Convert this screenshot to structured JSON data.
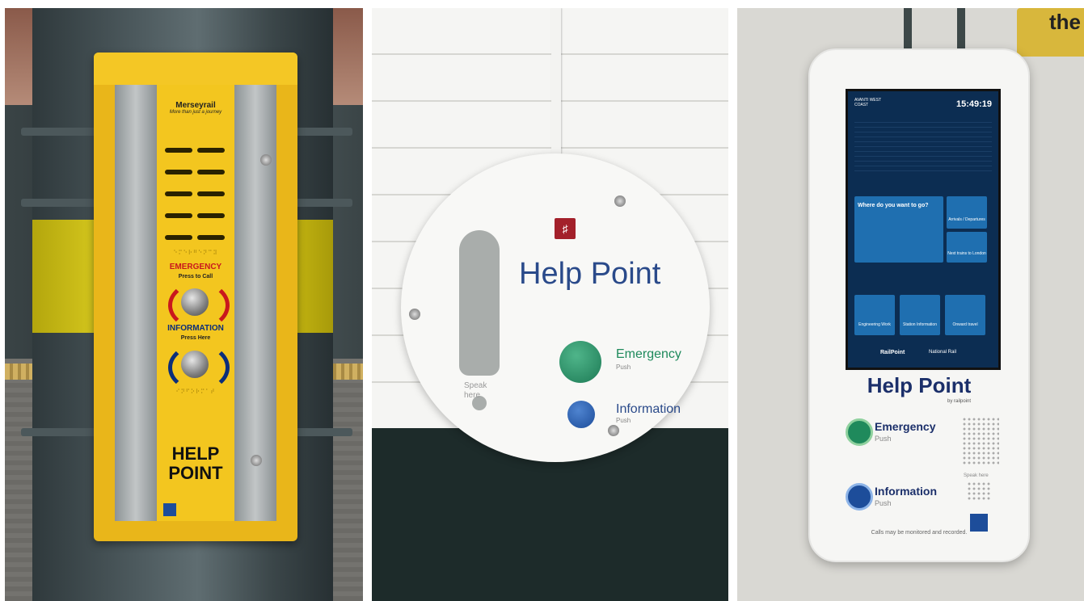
{
  "panels": {
    "merseyrail": {
      "brand": "Merseyrail",
      "tagline": "More than just a journey",
      "emergency_label": "EMERGENCY",
      "emergency_sub": "Press to Call",
      "information_label": "INFORMATION",
      "information_sub": "Press Here",
      "title_line1": "HELP",
      "title_line2": "POINT"
    },
    "round": {
      "title": "Help Point",
      "emergency_label": "Emergency",
      "emergency_push": "Push",
      "information_label": "Information",
      "information_push": "Push",
      "speak_here": "Speak here"
    },
    "kiosk": {
      "operator": "AVANTI WEST COAST",
      "clock": "15:49:19",
      "question": "Where do you want to go?",
      "tile_arrivals": "Arrivals / Departures",
      "tile_london": "Next trains to London",
      "tile_engineering": "Engineering Work",
      "tile_station": "Station Information",
      "tile_onward": "Onward travel",
      "footer_brand": "RailPoint",
      "footer_national": "National Rail",
      "title": "Help Point",
      "byline": "by railpoint",
      "emergency_label": "Emergency",
      "emergency_push": "Push",
      "information_label": "Information",
      "information_push": "Push",
      "speak_here": "Speak here",
      "notice": "Calls may be monitored and recorded.",
      "sign_text": "the"
    }
  },
  "colors": {
    "merseyrail_yellow": "#f3c61f",
    "emergency_green": "#1f8a5c",
    "information_blue": "#2a4a8a",
    "emergency_red": "#c9181d"
  }
}
